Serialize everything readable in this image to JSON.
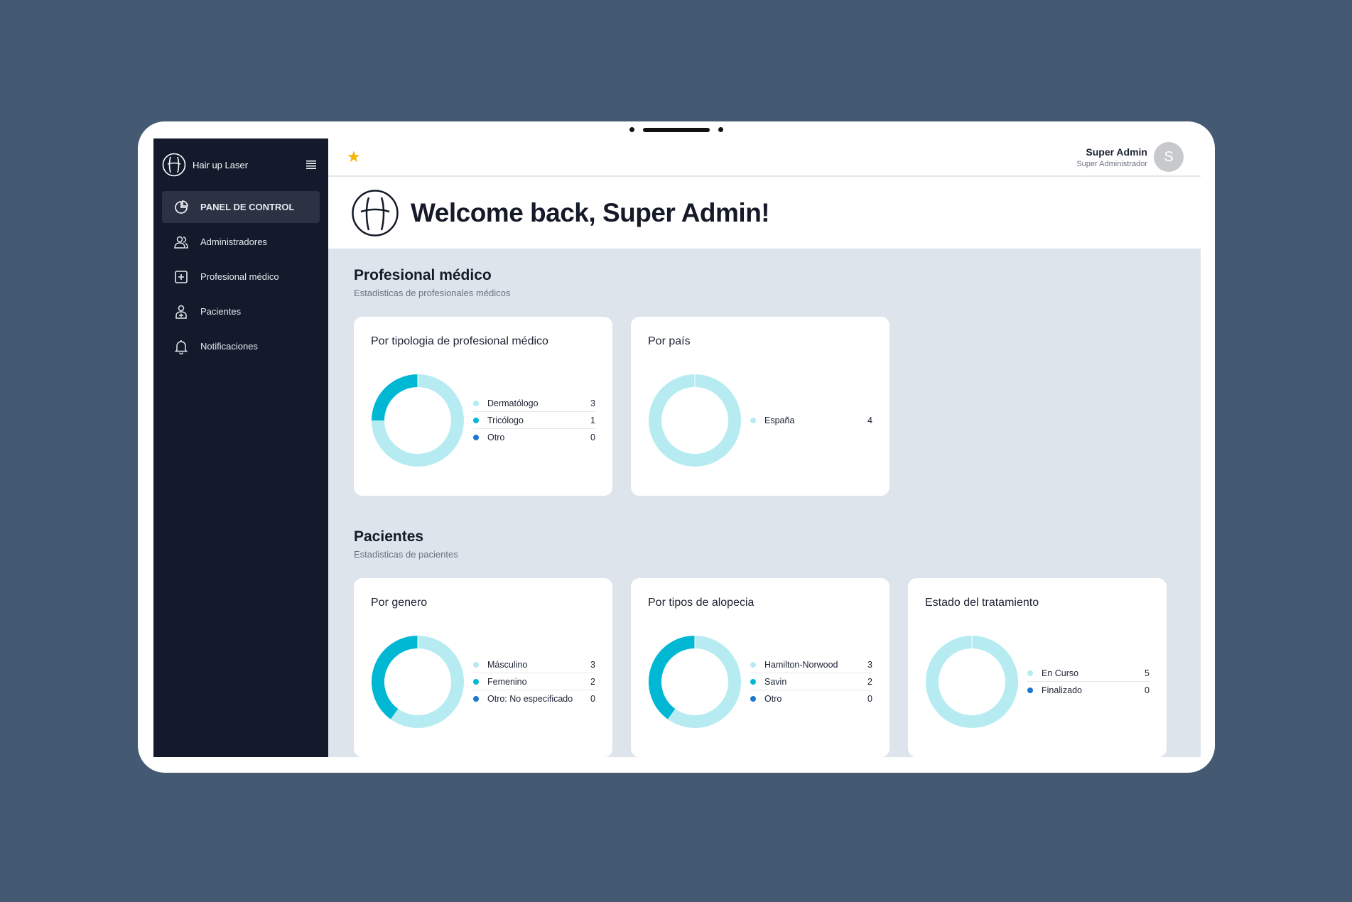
{
  "colors": {
    "background": "#445a73",
    "sidebar": "#121a2b",
    "accent": "#00b8d4",
    "light_cyan": "#b6ecf1",
    "blue": "#1e76d1",
    "star": "#f5b500"
  },
  "sidebar": {
    "brand_name": "Hair up Laser",
    "items": [
      {
        "label": "PANEL DE CONTROL",
        "icon": "pie-chart-icon",
        "active": true
      },
      {
        "label": "Administradores",
        "icon": "users-icon",
        "active": false
      },
      {
        "label": "Profesional médico",
        "icon": "plus-square-icon",
        "active": false
      },
      {
        "label": "Pacientes",
        "icon": "patient-icon",
        "active": false
      },
      {
        "label": "Notificaciones",
        "icon": "bell-icon",
        "active": false
      }
    ]
  },
  "topbar": {
    "user_name": "Super Admin",
    "user_role": "Super Administrador",
    "avatar_initial": "S"
  },
  "welcome": {
    "title": "Welcome back, Super Admin!"
  },
  "sections": [
    {
      "title": "Profesional médico",
      "subtitle": "Estadisticas de profesionales médicos",
      "cards": [
        {
          "title": "Por tipologia de profesional médico",
          "items": [
            {
              "label": "Dermatólogo",
              "value": 3,
              "color": "#b6ecf1"
            },
            {
              "label": "Tricólogo",
              "value": 1,
              "color": "#00b8d4"
            },
            {
              "label": "Otro",
              "value": 0,
              "color": "#1e76d1"
            }
          ]
        },
        {
          "title": "Por país",
          "items": [
            {
              "label": "España",
              "value": 4,
              "color": "#b6ecf1"
            }
          ]
        }
      ]
    },
    {
      "title": "Pacientes",
      "subtitle": "Estadisticas de pacientes",
      "cards": [
        {
          "title": "Por genero",
          "items": [
            {
              "label": "Másculino",
              "value": 3,
              "color": "#b6ecf1"
            },
            {
              "label": "Femenino",
              "value": 2,
              "color": "#00b8d4"
            },
            {
              "label": "Otro: No especificado",
              "value": 0,
              "color": "#1e76d1"
            }
          ]
        },
        {
          "title": "Por tipos de alopecia",
          "items": [
            {
              "label": "Hamilton-Norwood",
              "value": 3,
              "color": "#b6ecf1"
            },
            {
              "label": "Savin",
              "value": 2,
              "color": "#00b8d4"
            },
            {
              "label": "Otro",
              "value": 0,
              "color": "#1e76d1"
            }
          ]
        },
        {
          "title": "Estado del tratamiento",
          "items": [
            {
              "label": "En Curso",
              "value": 5,
              "color": "#b6ecf1"
            },
            {
              "label": "Finalizado",
              "value": 0,
              "color": "#1e76d1"
            }
          ]
        }
      ]
    }
  ]
}
